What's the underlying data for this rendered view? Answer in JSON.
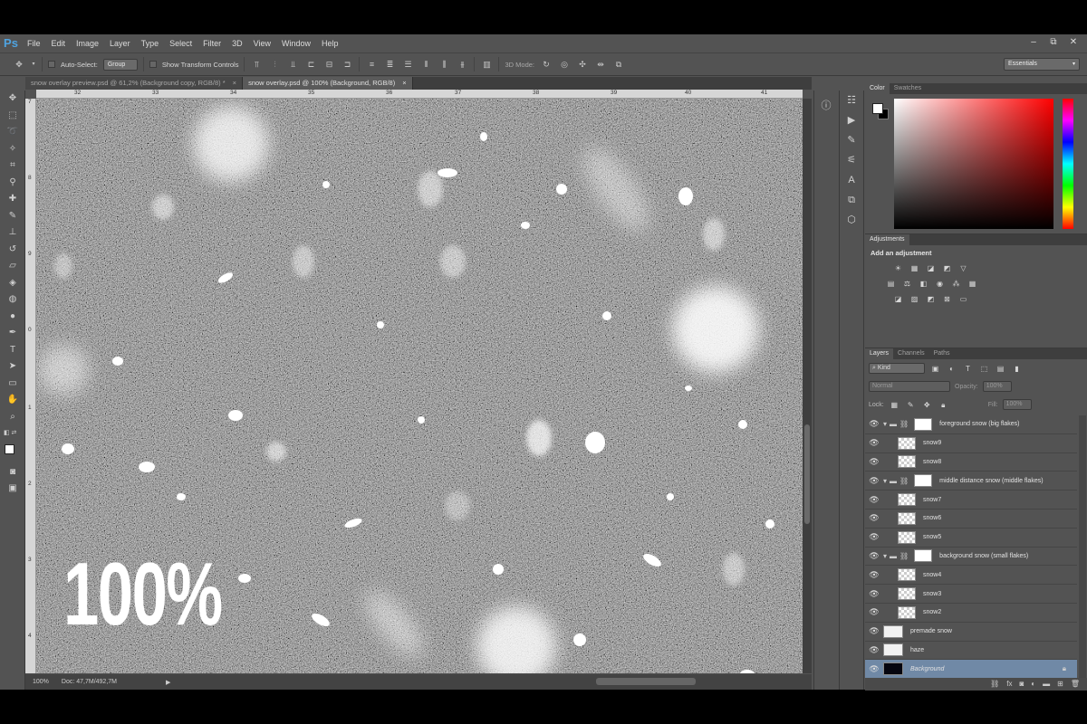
{
  "menubar": {
    "logo": "Ps",
    "items": [
      "File",
      "Edit",
      "Image",
      "Layer",
      "Type",
      "Select",
      "Filter",
      "3D",
      "View",
      "Window",
      "Help"
    ],
    "window_controls": [
      "‒",
      "⧉",
      "✕"
    ]
  },
  "options": {
    "auto_select_label": "Auto-Select:",
    "auto_select_value": "Group",
    "transform_label": "Show Transform Controls",
    "mode_3d_label": "3D Mode:",
    "workspace": "Essentials"
  },
  "doc_tabs": [
    {
      "title": "snow overlay preview.psd @ 61,2% (Background copy, RGB/8) *",
      "close": "×"
    },
    {
      "title": "snow overlay.psd @ 100% (Background, RGB/8)",
      "close": "×"
    }
  ],
  "ruler": {
    "h_ticks": [
      "32",
      "33",
      "34",
      "35",
      "36",
      "37",
      "38",
      "39",
      "40",
      "41"
    ],
    "v_ticks": [
      "7",
      "8",
      "9",
      "0",
      "1",
      "2",
      "3",
      "4"
    ]
  },
  "canvas": {
    "overlay_text": "100%",
    "bg_color": "#3a3a3a"
  },
  "status": {
    "zoom": "100%",
    "doc": "Doc: 47,7M/492,7M",
    "arrow": "▶"
  },
  "color_panel": {
    "tabs": [
      "Color",
      "Swatches"
    ],
    "foreground": "#ffffff",
    "background": "#000000",
    "hue": "#ff0000"
  },
  "adjustments": {
    "tab": "Adjustments",
    "title": "Add an adjustment"
  },
  "layers_panel": {
    "tabs": [
      "Layers",
      "Channels",
      "Paths"
    ],
    "kind": "Kind",
    "blend": "Normal",
    "opacity_label": "Opacity:",
    "opacity_value": "100%",
    "lock_label": "Lock:",
    "fill_label": "Fill:",
    "fill_value": "100%",
    "layers": [
      {
        "name": "foreground snow (big flakes)",
        "type": "group"
      },
      {
        "name": "snow9",
        "type": "layer"
      },
      {
        "name": "snow8",
        "type": "layer"
      },
      {
        "name": "middle distance snow (middle flakes)",
        "type": "group"
      },
      {
        "name": "snow7",
        "type": "layer"
      },
      {
        "name": "snow6",
        "type": "layer"
      },
      {
        "name": "snow5",
        "type": "layer"
      },
      {
        "name": "background snow (small flakes)",
        "type": "group"
      },
      {
        "name": "snow4",
        "type": "layer"
      },
      {
        "name": "snow3",
        "type": "layer"
      },
      {
        "name": "snow2",
        "type": "layer"
      },
      {
        "name": "premade snow",
        "type": "top"
      },
      {
        "name": "haze",
        "type": "top"
      },
      {
        "name": "Background",
        "type": "background",
        "selected": true
      }
    ]
  }
}
